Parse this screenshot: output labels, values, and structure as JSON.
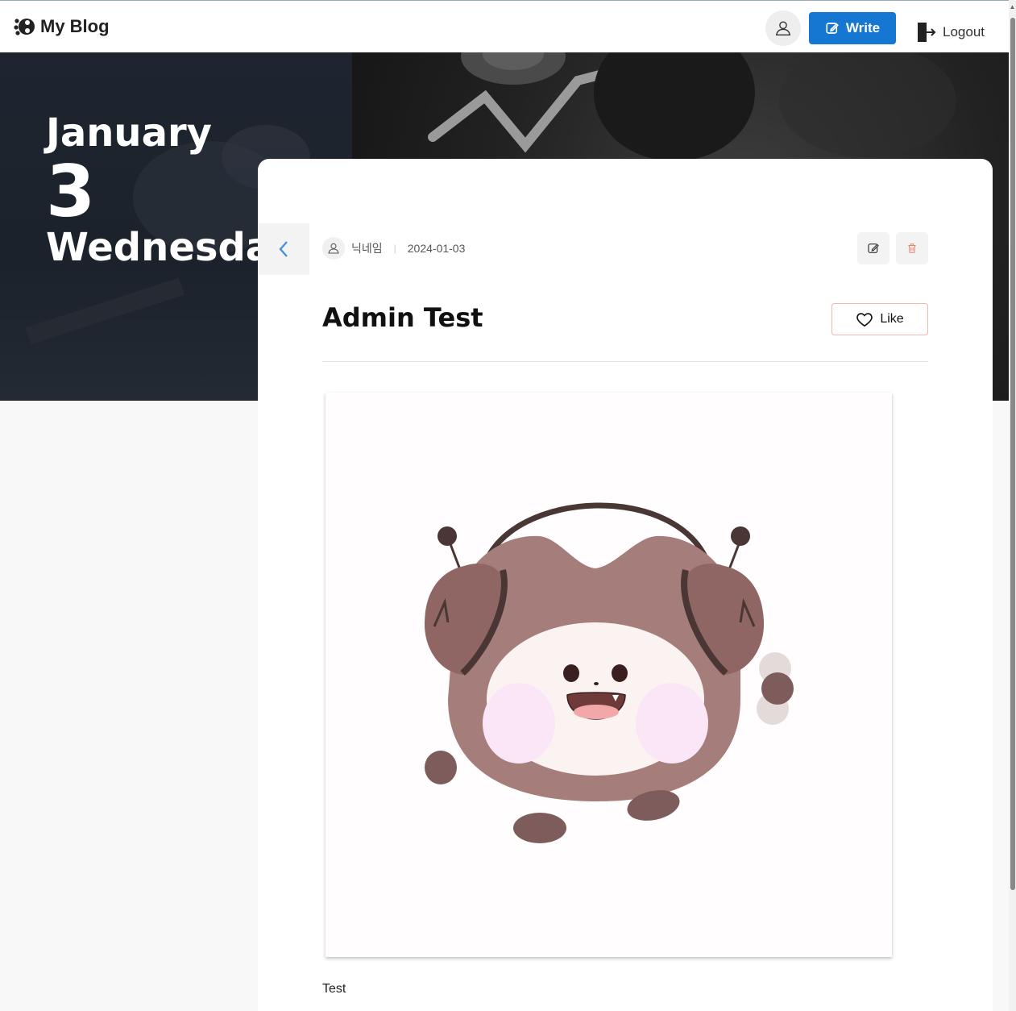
{
  "header": {
    "logo_text": "My Blog",
    "write_label": "Write",
    "logout_label": "Logout",
    "icons": {
      "logo": "blog-logo-icon",
      "profile": "user-icon",
      "write": "edit-icon",
      "logout": "logout-icon"
    }
  },
  "hero": {
    "month": "January",
    "day": "3",
    "weekday": "Wednesday"
  },
  "post": {
    "author": "닉네임",
    "date": "2024-01-03",
    "title": "Admin Test",
    "like_label": "Like",
    "body": "Test",
    "image_alt": "mascot-with-headphones"
  },
  "colors": {
    "accent": "#1677d2",
    "like_border": "#f0b8b0",
    "delete_icon": "#e8846f",
    "back_arrow": "#3d8ee0"
  }
}
